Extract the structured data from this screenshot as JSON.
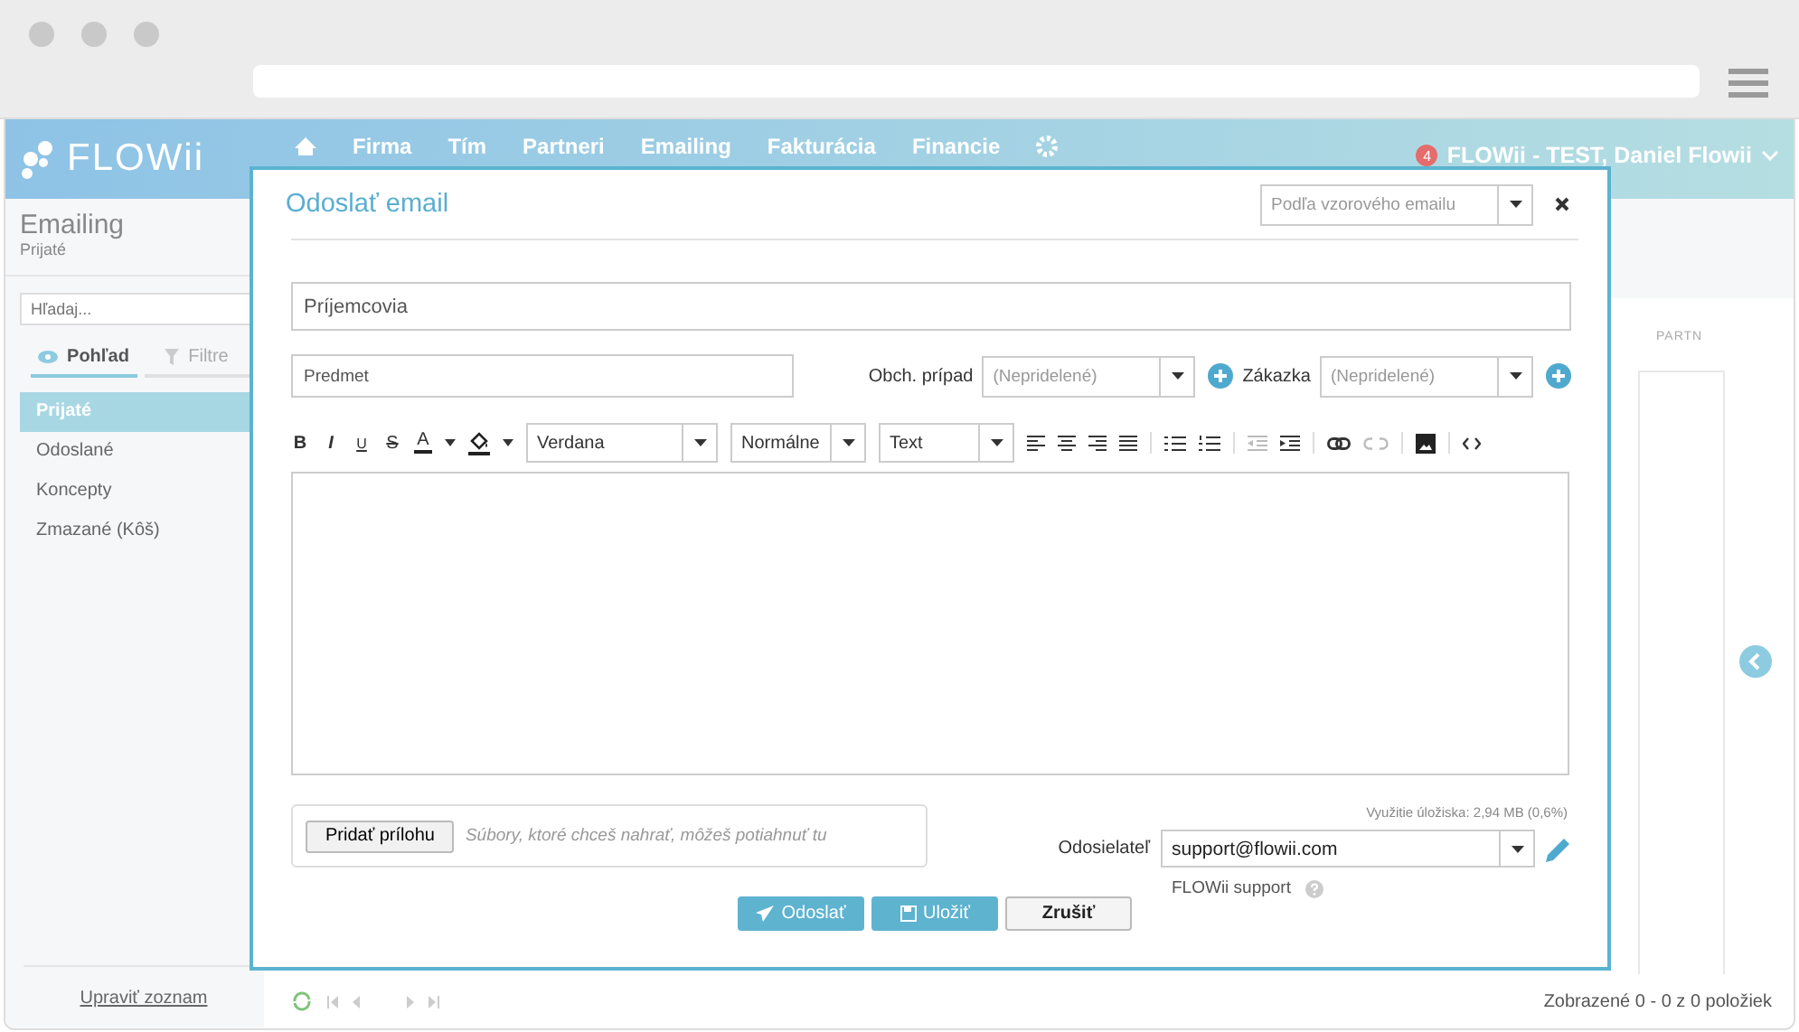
{
  "header": {
    "logo": "FLOWii",
    "nav": [
      "Firma",
      "Tím",
      "Partneri",
      "Emailing",
      "Fakturácia",
      "Financie"
    ],
    "notification_count": "4",
    "user": "FLOWii - TEST, Daniel Flowii"
  },
  "sidebar": {
    "title": "Emailing",
    "subtitle": "Prijaté",
    "search": {
      "placeholder": "Hľadaj..."
    },
    "tabs": [
      {
        "label": "Pohľad",
        "selected": true
      },
      {
        "label": "Filtre",
        "selected": false
      }
    ],
    "items": [
      {
        "label": "Prijaté",
        "selected": true
      },
      {
        "label": "Odoslané",
        "selected": false
      },
      {
        "label": "Koncepty",
        "selected": false
      },
      {
        "label": "Zmazané (Kôš)",
        "selected": false
      }
    ],
    "footer_link": "Upraviť zoznam"
  },
  "content": {
    "column_header": "PARTN",
    "status": "Zobrazené 0 - 0 z 0 položiek"
  },
  "modal": {
    "title": "Odoslať email",
    "template": {
      "placeholder": "Podľa vzorového emailu"
    },
    "recipients": {
      "placeholder": "Príjemcovia"
    },
    "subject": {
      "placeholder": "Predmet"
    },
    "case": {
      "label": "Obch. prípad",
      "value": "(Nepridelené)"
    },
    "order": {
      "label": "Zákazka",
      "value": "(Nepridelené)"
    },
    "toolbar": {
      "format_buttons": [
        "B",
        "I",
        "U",
        "S"
      ],
      "text_color": "A",
      "font": "Verdana",
      "size": "Normálne",
      "format": "Text"
    },
    "attach_button": "Pridať prílohu",
    "drop_hint": "Súbory, ktoré chceš nahrať, môžeš potiahnuť tu",
    "storage": "Využitie úložiska: 2,94 MB (0,6%)",
    "sender": {
      "label": "Odosielateľ",
      "value": "support@flowii.com",
      "name": "FLOWii support"
    },
    "buttons": [
      {
        "label": "Odoslať",
        "kind": "send"
      },
      {
        "label": "Uložiť",
        "kind": "save"
      },
      {
        "label": "Zrušiť",
        "kind": "cancel"
      }
    ]
  }
}
